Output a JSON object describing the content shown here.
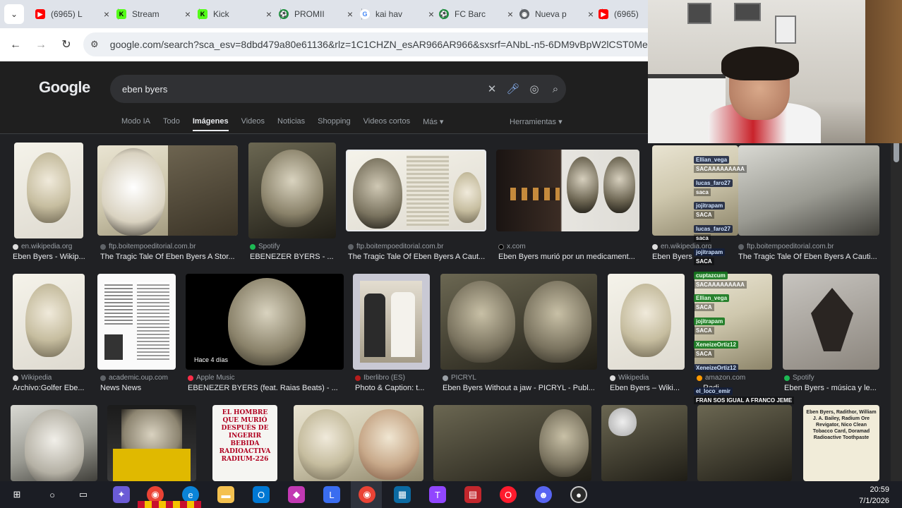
{
  "browser": {
    "tabs": [
      {
        "label": "(6965) L",
        "icon": "youtube-icon",
        "color": "#ff0000"
      },
      {
        "label": "Stream",
        "icon": "kick-icon",
        "color": "#53fc18"
      },
      {
        "label": "Kick",
        "icon": "kick-icon",
        "color": "#53fc18"
      },
      {
        "label": "PROMII",
        "icon": "soccer-icon",
        "color": "#1e8e3e"
      },
      {
        "label": "kai hav",
        "icon": "google-icon",
        "color": "#4285f4"
      },
      {
        "label": "FC Barc",
        "icon": "soccer-icon",
        "color": "#1e8e3e"
      },
      {
        "label": "Nueva p",
        "icon": "chrome-icon",
        "color": "#5f6368"
      },
      {
        "label": "(6965)",
        "icon": "youtube-icon",
        "color": "#ff0000"
      }
    ],
    "url": "google.com/search?sca_esv=8dbd479a80e61136&rlz=1C1CHZN_esAR966AR966&sxsrf=ANbL-n5-6DM9vBpW2lCST0MehUC"
  },
  "google": {
    "logo": "Google",
    "query": "eben byers",
    "tabs": [
      "Modo IA",
      "Todo",
      "Imágenes",
      "Videos",
      "Noticias",
      "Shopping",
      "Videos cortos",
      "Más"
    ],
    "active_tab": "Imágenes",
    "tools": "Herramientas"
  },
  "results_row1": [
    {
      "source": "en.wikipedia.org",
      "title": "Eben Byers - Wikip..."
    },
    {
      "source": "ftp.boitempoeditorial.com.br",
      "title": "The Tragic Tale Of Eben Byers A Stor..."
    },
    {
      "source": "Spotify",
      "title": "EBENEZER BYERS - ..."
    },
    {
      "source": "ftp.boitempoeditorial.com.br",
      "title": "The Tragic Tale Of Eben Byers A Caut..."
    },
    {
      "source": "x.com",
      "title": "Eben Byers murió por un medicament..."
    },
    {
      "source": "en.wikipedia.org",
      "title": "Eben Byers"
    },
    {
      "source": "ftp.boitempoeditorial.com.br",
      "title": "The Tragic Tale Of Eben Byers A Cauti..."
    }
  ],
  "results_row2": [
    {
      "source": "Wikipedia",
      "title": "Archivo:Golfer Ebe..."
    },
    {
      "source": "academic.oup.com",
      "title": "News News"
    },
    {
      "source": "Apple Music",
      "title": "EBENEZER BYERS (feat. Raias Beats) - ...",
      "badge": "Hace 4 días"
    },
    {
      "source": "Iberlibro (ES)",
      "title": "Photo & Caption: t..."
    },
    {
      "source": "PICRYL",
      "title": "Eben Byers Without a jaw - PICRYL - Publ..."
    },
    {
      "source": "Wikipedia",
      "title": "Eben Byers – Wiki..."
    },
    {
      "source": "amazon.com",
      "title": "...Radi..."
    },
    {
      "source": "Spotify",
      "title": "Eben Byers - música y le..."
    }
  ],
  "row3_texts": {
    "newspaper": "EL HOMBRE QUE MURIÓ DESPUÉS DE INGERIR BEBIDA RADIOACTIVA RADIUM-226",
    "trading_card": "Eben Byers, Radithor, William J. A. Bailey, Radium Ore Revigator, Nico Clean Tobacco Card, Doramad Radioactive Toothpaste"
  },
  "chat": [
    {
      "user": "Ellian_vega",
      "text": "SACAAAAAAAAA"
    },
    {
      "user": "lucas_faro27",
      "text": "saca"
    },
    {
      "user": "jojitrapam",
      "text": "SACA"
    },
    {
      "user": "lucas_faro27",
      "text": "saca"
    },
    {
      "user": "jojitrapam",
      "text": "SACA"
    },
    {
      "user": "cuptazcum",
      "text": "SACAAAAAAAAA"
    },
    {
      "user": "Ellian_vega",
      "text": "SACA"
    },
    {
      "user": "jojitrapam",
      "text": "SACA"
    },
    {
      "user": "XeneizeOrtiz12",
      "text": "SACA"
    },
    {
      "user": "XeneizeOrtiz12",
      "text": ""
    },
    {
      "user": "el_loco_emir",
      "text": "FRAN SOS IGUAL A FRANCO JEME"
    }
  ],
  "taskbar": {
    "time": "20:59",
    "date": "7/1/2026"
  },
  "colors": {
    "bg": "#202124",
    "header": "#1f1f1f",
    "tabstrip": "#dfe3ea",
    "taskbar": "#1b1d24"
  }
}
